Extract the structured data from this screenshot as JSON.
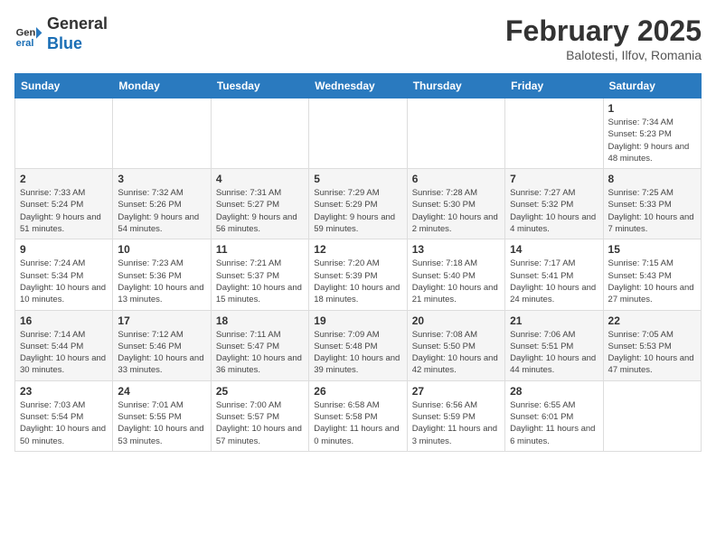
{
  "header": {
    "logo_general": "General",
    "logo_blue": "Blue",
    "month_year": "February 2025",
    "location": "Balotesti, Ilfov, Romania"
  },
  "weekdays": [
    "Sunday",
    "Monday",
    "Tuesday",
    "Wednesday",
    "Thursday",
    "Friday",
    "Saturday"
  ],
  "weeks": [
    [
      {
        "day": "",
        "info": ""
      },
      {
        "day": "",
        "info": ""
      },
      {
        "day": "",
        "info": ""
      },
      {
        "day": "",
        "info": ""
      },
      {
        "day": "",
        "info": ""
      },
      {
        "day": "",
        "info": ""
      },
      {
        "day": "1",
        "info": "Sunrise: 7:34 AM\nSunset: 5:23 PM\nDaylight: 9 hours and 48 minutes."
      }
    ],
    [
      {
        "day": "2",
        "info": "Sunrise: 7:33 AM\nSunset: 5:24 PM\nDaylight: 9 hours and 51 minutes."
      },
      {
        "day": "3",
        "info": "Sunrise: 7:32 AM\nSunset: 5:26 PM\nDaylight: 9 hours and 54 minutes."
      },
      {
        "day": "4",
        "info": "Sunrise: 7:31 AM\nSunset: 5:27 PM\nDaylight: 9 hours and 56 minutes."
      },
      {
        "day": "5",
        "info": "Sunrise: 7:29 AM\nSunset: 5:29 PM\nDaylight: 9 hours and 59 minutes."
      },
      {
        "day": "6",
        "info": "Sunrise: 7:28 AM\nSunset: 5:30 PM\nDaylight: 10 hours and 2 minutes."
      },
      {
        "day": "7",
        "info": "Sunrise: 7:27 AM\nSunset: 5:32 PM\nDaylight: 10 hours and 4 minutes."
      },
      {
        "day": "8",
        "info": "Sunrise: 7:25 AM\nSunset: 5:33 PM\nDaylight: 10 hours and 7 minutes."
      }
    ],
    [
      {
        "day": "9",
        "info": "Sunrise: 7:24 AM\nSunset: 5:34 PM\nDaylight: 10 hours and 10 minutes."
      },
      {
        "day": "10",
        "info": "Sunrise: 7:23 AM\nSunset: 5:36 PM\nDaylight: 10 hours and 13 minutes."
      },
      {
        "day": "11",
        "info": "Sunrise: 7:21 AM\nSunset: 5:37 PM\nDaylight: 10 hours and 15 minutes."
      },
      {
        "day": "12",
        "info": "Sunrise: 7:20 AM\nSunset: 5:39 PM\nDaylight: 10 hours and 18 minutes."
      },
      {
        "day": "13",
        "info": "Sunrise: 7:18 AM\nSunset: 5:40 PM\nDaylight: 10 hours and 21 minutes."
      },
      {
        "day": "14",
        "info": "Sunrise: 7:17 AM\nSunset: 5:41 PM\nDaylight: 10 hours and 24 minutes."
      },
      {
        "day": "15",
        "info": "Sunrise: 7:15 AM\nSunset: 5:43 PM\nDaylight: 10 hours and 27 minutes."
      }
    ],
    [
      {
        "day": "16",
        "info": "Sunrise: 7:14 AM\nSunset: 5:44 PM\nDaylight: 10 hours and 30 minutes."
      },
      {
        "day": "17",
        "info": "Sunrise: 7:12 AM\nSunset: 5:46 PM\nDaylight: 10 hours and 33 minutes."
      },
      {
        "day": "18",
        "info": "Sunrise: 7:11 AM\nSunset: 5:47 PM\nDaylight: 10 hours and 36 minutes."
      },
      {
        "day": "19",
        "info": "Sunrise: 7:09 AM\nSunset: 5:48 PM\nDaylight: 10 hours and 39 minutes."
      },
      {
        "day": "20",
        "info": "Sunrise: 7:08 AM\nSunset: 5:50 PM\nDaylight: 10 hours and 42 minutes."
      },
      {
        "day": "21",
        "info": "Sunrise: 7:06 AM\nSunset: 5:51 PM\nDaylight: 10 hours and 44 minutes."
      },
      {
        "day": "22",
        "info": "Sunrise: 7:05 AM\nSunset: 5:53 PM\nDaylight: 10 hours and 47 minutes."
      }
    ],
    [
      {
        "day": "23",
        "info": "Sunrise: 7:03 AM\nSunset: 5:54 PM\nDaylight: 10 hours and 50 minutes."
      },
      {
        "day": "24",
        "info": "Sunrise: 7:01 AM\nSunset: 5:55 PM\nDaylight: 10 hours and 53 minutes."
      },
      {
        "day": "25",
        "info": "Sunrise: 7:00 AM\nSunset: 5:57 PM\nDaylight: 10 hours and 57 minutes."
      },
      {
        "day": "26",
        "info": "Sunrise: 6:58 AM\nSunset: 5:58 PM\nDaylight: 11 hours and 0 minutes."
      },
      {
        "day": "27",
        "info": "Sunrise: 6:56 AM\nSunset: 5:59 PM\nDaylight: 11 hours and 3 minutes."
      },
      {
        "day": "28",
        "info": "Sunrise: 6:55 AM\nSunset: 6:01 PM\nDaylight: 11 hours and 6 minutes."
      },
      {
        "day": "",
        "info": ""
      }
    ]
  ]
}
